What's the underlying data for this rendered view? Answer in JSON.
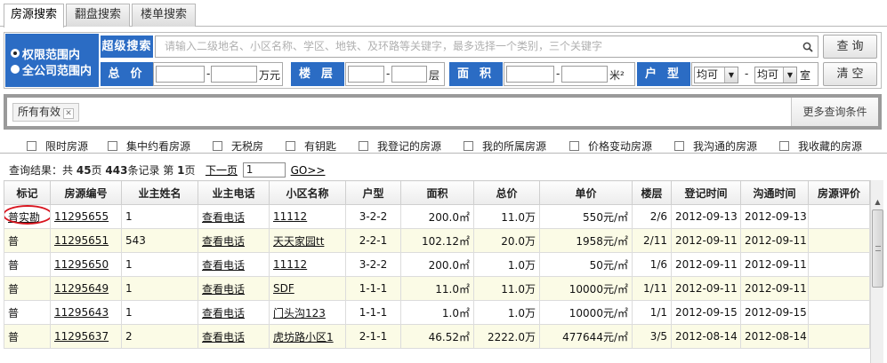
{
  "tabs": [
    {
      "label": "房源搜索",
      "active": true
    },
    {
      "label": "翻盘搜索",
      "active": false
    },
    {
      "label": "楼单搜索",
      "active": false
    }
  ],
  "search": {
    "scope": [
      {
        "label": "权限范围内",
        "selected": true
      },
      {
        "label": "全公司范围内",
        "selected": false
      }
    ],
    "super_label": "超级搜索",
    "super_placeholder": "请输入二级地名、小区名称、学区、地铁、及环路等关键字，最多选择一个类别，三个关键字",
    "query_button": "查询",
    "clear_button": "清空",
    "price_label": "总价",
    "price_unit": "万元",
    "floor_label": "楼层",
    "floor_unit": "层",
    "area_label": "面积",
    "area_unit": "米²",
    "layout_label": "户型",
    "layout_select_1": "均可",
    "layout_select_2": "均可",
    "layout_unit": "室",
    "range_dash": "-"
  },
  "filter": {
    "chip": "所有有效",
    "more_button": "更多查询条件"
  },
  "checkboxes": [
    "限时房源",
    "集中约看房源",
    "无税房",
    "有钥匙",
    "我登记的房源",
    "我的所属房源",
    "价格变动房源",
    "我沟通的房源",
    "我收藏的房源"
  ],
  "results": {
    "prefix": "查询结果：共",
    "pages": "45",
    "pages_unit": "页",
    "records": "443",
    "records_unit": "条记录 第",
    "current": "1",
    "current_unit": "页",
    "next": "下一页",
    "page_input": "1",
    "go": "GO>>"
  },
  "table": {
    "headers": [
      "标记",
      "房源编号",
      "业主姓名",
      "业主电话",
      "小区名称",
      "户型",
      "面积",
      "总价",
      "单价",
      "楼层",
      "登记时间",
      "沟通时间",
      "房源评价"
    ],
    "rows": [
      {
        "mark": "普实勘",
        "id": "11295655",
        "owner": "1",
        "phone": "查看电话",
        "community": "11112",
        "layout": "3-2-2",
        "area": "200.0㎡",
        "price": "11.0万",
        "unit_price": "550元/㎡",
        "floor": "2/6",
        "reg": "2012-09-13",
        "comm": "2012-09-13",
        "eval": ""
      },
      {
        "mark": "普",
        "id": "11295651",
        "owner": "543",
        "phone": "查看电话",
        "community": "天天家园tt",
        "layout": "2-2-1",
        "area": "102.12㎡",
        "price": "20.0万",
        "unit_price": "1958元/㎡",
        "floor": "2/11",
        "reg": "2012-09-11",
        "comm": "2012-09-11",
        "eval": ""
      },
      {
        "mark": "普",
        "id": "11295650",
        "owner": "1",
        "phone": "查看电话",
        "community": "11112",
        "layout": "3-2-2",
        "area": "200.0㎡",
        "price": "1.0万",
        "unit_price": "50元/㎡",
        "floor": "1/6",
        "reg": "2012-09-11",
        "comm": "2012-09-11",
        "eval": ""
      },
      {
        "mark": "普",
        "id": "11295649",
        "owner": "1",
        "phone": "查看电话",
        "community": "SDF",
        "layout": "1-1-1",
        "area": "11.0㎡",
        "price": "11.0万",
        "unit_price": "10000元/㎡",
        "floor": "1/11",
        "reg": "2012-09-11",
        "comm": "2012-09-11",
        "eval": ""
      },
      {
        "mark": "普",
        "id": "11295643",
        "owner": "1",
        "phone": "查看电话",
        "community": "门头沟123",
        "layout": "1-1-1",
        "area": "1.0㎡",
        "price": "1.0万",
        "unit_price": "10000元/㎡",
        "floor": "1/1",
        "reg": "2012-09-15",
        "comm": "2012-09-15",
        "eval": ""
      },
      {
        "mark": "普",
        "id": "11295637",
        "owner": "2",
        "phone": "查看电话",
        "community": "虎坊路小区1",
        "layout": "2-1-1",
        "area": "46.52㎡",
        "price": "2222.0万",
        "unit_price": "477644元/㎡",
        "floor": "3/5",
        "reg": "2012-08-14",
        "comm": "2012-08-14",
        "eval": ""
      }
    ]
  },
  "colors": {
    "accent": "#2b6cc4",
    "highlight_oval": "#d8141e",
    "alt_row": "#fbfbe6"
  }
}
